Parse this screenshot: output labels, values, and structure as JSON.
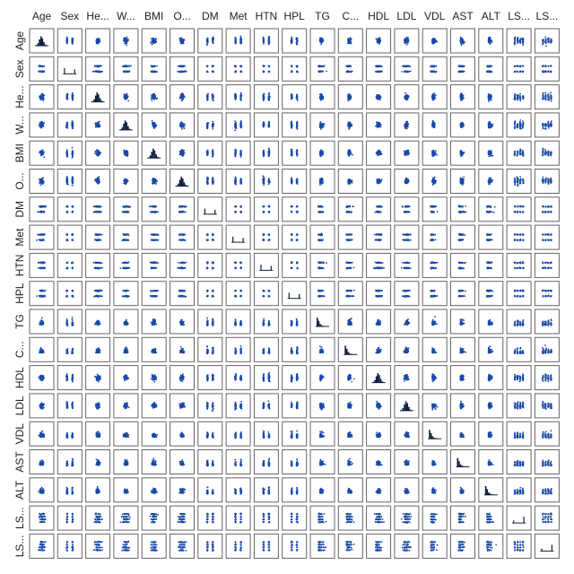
{
  "chart_data": {
    "type": "scatter",
    "variables": [
      "Age",
      "Sex",
      "He...",
      "W...",
      "BMI",
      "O...",
      "DM",
      "Met",
      "HTN",
      "HPL",
      "TG",
      "C...",
      "HDL",
      "LDL",
      "VDL",
      "AST",
      "ALT",
      "LS...",
      "LS..."
    ],
    "column_labels": [
      "Age",
      "Sex",
      "He...",
      "W...",
      "BMI",
      "O...",
      "DM",
      "Met",
      "HTN",
      "HPL",
      "TG",
      "C...",
      "HDL",
      "LDL",
      "VDL",
      "AST",
      "ALT",
      "LS...",
      "LS..."
    ],
    "row_labels": [
      "Age",
      "Sex",
      "He...",
      "W...",
      "BMI",
      "O...",
      "DM",
      "Met",
      "HTN",
      "HPL",
      "TG",
      "C...",
      "HDL",
      "LDL",
      "VDL",
      "AST",
      "ALT",
      "LS...",
      "LS..."
    ],
    "variable_kinds": [
      "continuous",
      "binary",
      "continuous",
      "continuous",
      "continuous",
      "continuous",
      "binary",
      "binary",
      "binary",
      "binary",
      "skewed",
      "skewed",
      "continuous",
      "continuous",
      "skewed",
      "skewed",
      "skewed",
      "ordinal",
      "ordinal"
    ],
    "diagonal": "histogram",
    "off_diagonal": "scatter",
    "grid": false,
    "colors": {
      "marker": "#1a4aa8",
      "histogram": "#0d1f3c",
      "panel_border": "#666666"
    }
  }
}
